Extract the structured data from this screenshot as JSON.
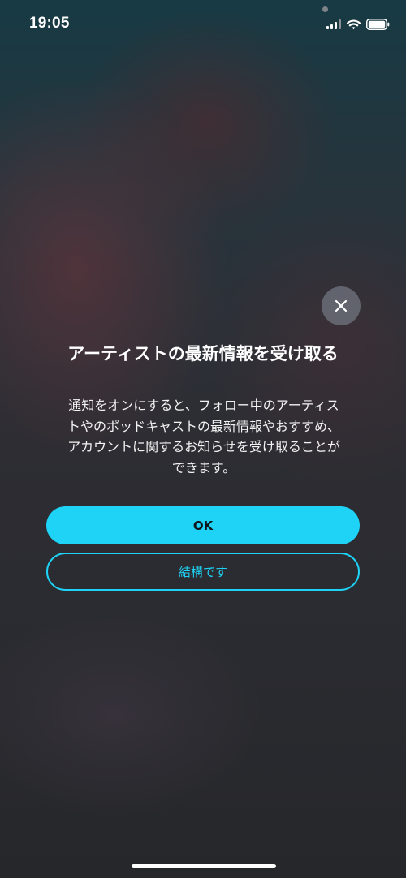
{
  "status_bar": {
    "time": "19:05",
    "icons": [
      "signal-icon",
      "wifi-icon",
      "battery-icon"
    ]
  },
  "dialog": {
    "close_icon": "close-icon",
    "title": "アーティストの最新情報を受け取る",
    "body_lines": [
      "通知をオンにすると、フォロー中のアーティス",
      "トやのポッドキャストの最新情報やおすすめ、",
      "アカウントに関するお知らせを受け取ることが",
      "できます。"
    ],
    "ok_label": "OK",
    "decline_label": "結構です"
  },
  "colors": {
    "accent": "#1ed3f5",
    "text": "#ffffff",
    "close_button_bg": "#707680"
  }
}
